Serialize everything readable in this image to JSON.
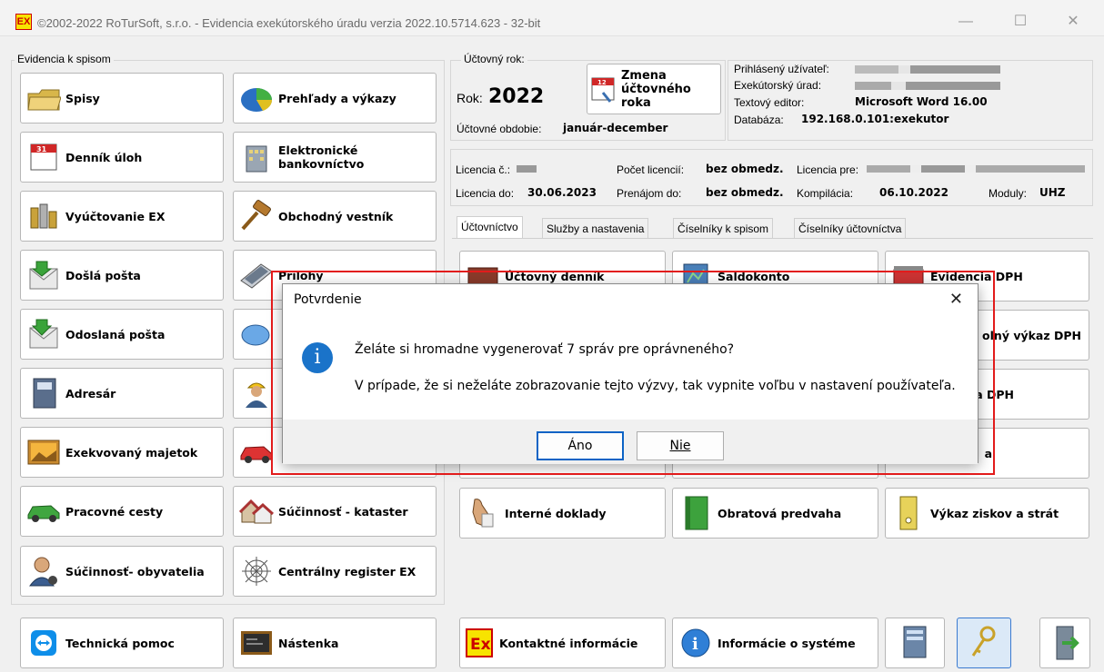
{
  "window": {
    "title": "©2002-2022 RoTurSoft, s.r.o. - Evidencia exekútorského úradu verzia 2022.10.5714.623 - 32-bit",
    "app_logo": "EX",
    "minimize": "—",
    "maximize": "☐",
    "close": "✕"
  },
  "left_group": {
    "label": "Evidencia k spisom",
    "col1": [
      {
        "label": "Spisy",
        "icon": "folder-icon"
      },
      {
        "label": "Denník úloh",
        "icon": "calendar-icon"
      },
      {
        "label": "Vyúčtovanie EX",
        "icon": "coins-icon"
      },
      {
        "label": "Došlá pošta",
        "icon": "incoming-mail-icon"
      },
      {
        "label": "Odoslaná pošta",
        "icon": "outgoing-mail-icon"
      },
      {
        "label": "Adresár",
        "icon": "address-book-icon"
      },
      {
        "label": "Exekvovaný majetok",
        "icon": "picture-icon"
      },
      {
        "label": "Pracovné cesty",
        "icon": "car-icon"
      },
      {
        "label": "Súčinnosť- obyvatelia",
        "icon": "person-icon"
      }
    ],
    "col2": [
      {
        "label": "Prehľady a výkazy",
        "icon": "pie-chart-icon"
      },
      {
        "label": "Elektronické bankovníctvo",
        "icon": "bank-icon"
      },
      {
        "label": "Obchodný vestník",
        "icon": "gavel-icon"
      },
      {
        "label": "Prílohy",
        "icon": "scanner-icon"
      },
      {
        "label": "",
        "icon": "piggy-bank-icon"
      },
      {
        "label": "",
        "icon": "worker-icon"
      },
      {
        "label": "",
        "icon": "red-car-icon"
      },
      {
        "label": "Súčinnosť - kataster",
        "icon": "houses-icon"
      },
      {
        "label": "Centrálny register EX",
        "icon": "spider-web-icon"
      }
    ]
  },
  "bottom_left": [
    {
      "label": "Technická pomoc",
      "icon": "teamviewer-icon"
    },
    {
      "label": "Nástenka",
      "icon": "chalkboard-icon"
    }
  ],
  "year_panel": {
    "label": "Účtovný rok:",
    "year_label": "Rok:",
    "year": "2022",
    "period_label": "Účtovné obdobie:",
    "period": "január-december",
    "change_button": "Zmena účtovného roka"
  },
  "user_panel": {
    "user_label": "Prihlásený užívateľ:",
    "office_label": "Exekútorský úrad:",
    "editor_label": "Textový editor:",
    "editor": "Microsoft Word 16.00",
    "db_label": "Databáza:",
    "db": "192.168.0.101:exekutor"
  },
  "license_panel": {
    "license_no_label": "Licencia č.:",
    "count_label": "Počet licencií:",
    "count": "bez obmedz.",
    "for_label": "Licencia pre:",
    "until_label": "Licencia do:",
    "until": "30.06.2023",
    "rent_label": "Prenájom do:",
    "rent": "bez obmedz.",
    "compile_label": "Kompilácia:",
    "compile": "06.10.2022",
    "modules_label": "Moduly:",
    "modules": "UHZ"
  },
  "tabs": [
    "Účtovníctvo",
    "Služby a nastavenia",
    "Číselníky k spisom",
    "Číselníky účtovníctva"
  ],
  "right_buttons": [
    {
      "label": "Účtovný denník",
      "icon": "ledger-icon"
    },
    {
      "label": "Saldokonto",
      "icon": "saldo-icon"
    },
    {
      "label": "Evidencia DPH",
      "icon": "vat-icon"
    },
    {
      "label": "olný výkaz DPH",
      "icon": ""
    },
    {
      "label": "nia DPH",
      "icon": ""
    },
    {
      "label": "a",
      "icon": ""
    },
    {
      "label": "Interné doklady",
      "icon": "hand-document-icon"
    },
    {
      "label": "Obratová predvaha",
      "icon": "green-book-icon"
    },
    {
      "label": "Výkaz ziskov a strát",
      "icon": "binder-icon"
    }
  ],
  "bottom_right": [
    {
      "label": "Kontaktné informácie",
      "icon": "ex-logo-icon"
    },
    {
      "label": "Informácie o systéme",
      "icon": "info-icon"
    }
  ],
  "dialog": {
    "title": "Potvrdenie",
    "message1": "Želáte si hromadne vygenerovať 7 správ pre oprávneného?",
    "message2": "V prípade, že si neželáte zobrazovanie tejto výzvy, tak vypnite voľbu v nastavení používateľa.",
    "yes": "Áno",
    "no": "Nie",
    "close": "✕"
  }
}
